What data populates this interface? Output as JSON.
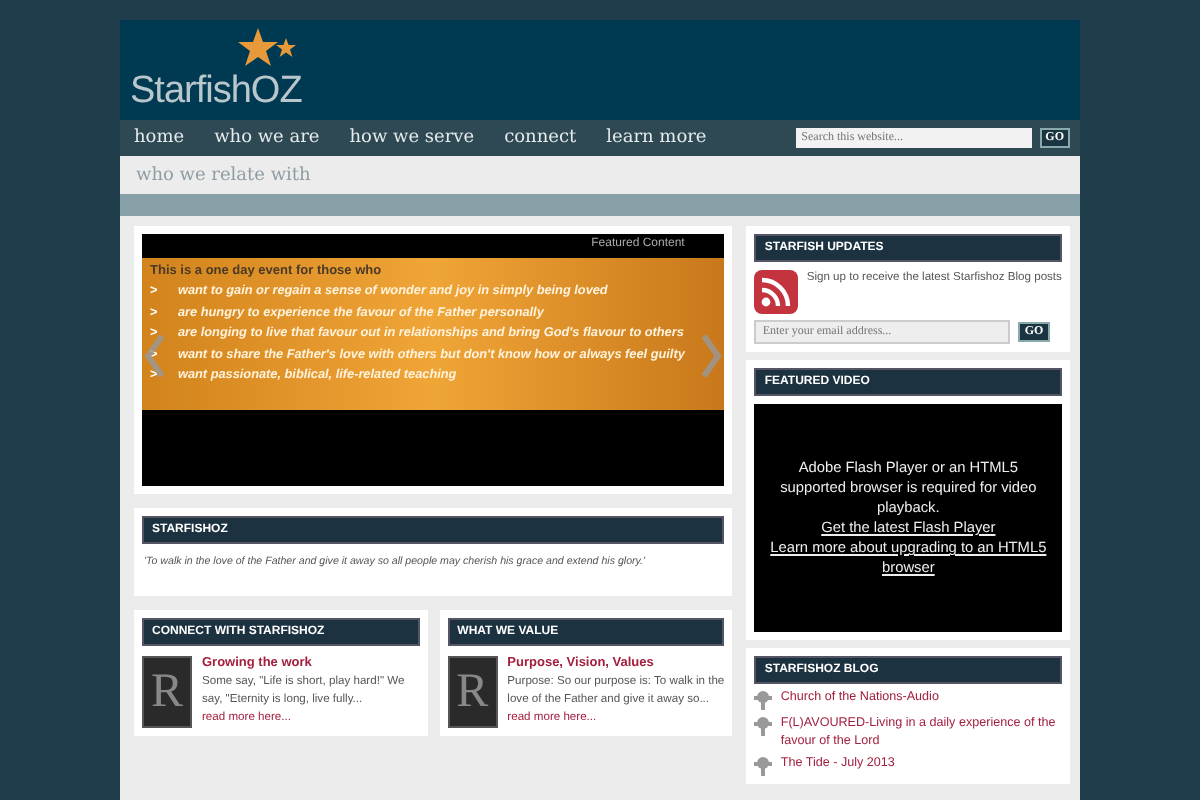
{
  "header": {
    "logo_text": "StarfishOZ"
  },
  "nav": {
    "items": [
      {
        "label": "home"
      },
      {
        "label": "who we are"
      },
      {
        "label": "how we serve"
      },
      {
        "label": "connect"
      },
      {
        "label": "learn more"
      }
    ],
    "search": {
      "placeholder": "Search this website...",
      "button": "GO"
    }
  },
  "subnav": {
    "label": "who we relate with"
  },
  "slider": {
    "caption": "Featured Content",
    "heading": "This is a one day event for those who",
    "bullet": ">",
    "points": [
      "want to gain or regain a sense of wonder and joy in simply being loved",
      "are hungry to experience the favour of the Father personally",
      "are longing to live that favour out in relationships and bring God's flavour to others",
      "want to share the Father's love with others but don't know how or always feel guilty",
      "want passionate, biblical, life-related teaching"
    ]
  },
  "mission": {
    "title": "STARFISHOZ",
    "text": "'To walk in the love of the Father and give it away so all people may cherish his grace and extend his glory.'"
  },
  "widgets": [
    {
      "title": "CONNECT WITH STARFISHOZ",
      "thumb_letter": "R",
      "post_title": "Growing the work",
      "excerpt": "Some say, \"Life is short, play hard!\" We say, \"Eternity is long, live fully...",
      "more": "read more here..."
    },
    {
      "title": "WHAT WE VALUE",
      "thumb_letter": "R",
      "post_title": "Purpose, Vision, Values",
      "excerpt": "Purpose: So our purpose is: To walk in the love of the Father and give it away so...",
      "more": "read more here..."
    }
  ],
  "updates": {
    "title": "STARFISH UPDATES",
    "text": "Sign up to receive the latest Starfishoz Blog posts",
    "placeholder": "Enter your email address...",
    "button": "GO"
  },
  "video": {
    "title": "FEATURED VIDEO",
    "message": "Adobe Flash Player or an HTML5 supported browser is required for video playback.",
    "links": [
      "Get the latest Flash Player",
      "Learn more about upgrading to an HTML5 browser"
    ]
  },
  "blog": {
    "title": "STARFISHOZ BLOG",
    "posts": [
      "Church of the Nations-Audio",
      "F(L)AVOURED-Living in a daily experience of the favour of the Lord",
      "The Tide - July 2013"
    ]
  }
}
